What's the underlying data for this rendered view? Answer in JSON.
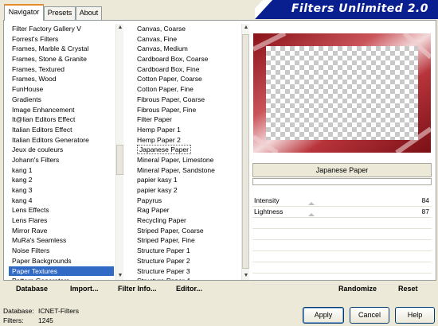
{
  "tabs": [
    "Navigator",
    "Presets",
    "About"
  ],
  "banner_title": "Filters Unlimited 2.0",
  "categories": [
    "Filter Factory Gallery V",
    "Forrest's Filters",
    "Frames, Marble & Crystal",
    "Frames, Stone & Granite",
    "Frames, Textured",
    "Frames, Wood",
    "FunHouse",
    "Gradients",
    "Image Enhancement",
    "It@lian Editors Effect",
    "Italian Editors Effect",
    "Italian Editors Generatore",
    "Jeux de couleurs",
    "Johann's Filters",
    "kang 1",
    "kang 2",
    "kang 3",
    "kang 4",
    "Lens Effects",
    "Lens Flares",
    "Mirror Rave",
    "MuRa's Seamless",
    "Noise Filters",
    "Paper Backgrounds",
    "Paper Textures",
    "Pattern Generators"
  ],
  "filters": [
    "Canvas, Coarse",
    "Canvas, Fine",
    "Canvas, Medium",
    "Cardboard Box, Coarse",
    "Cardboard Box, Fine",
    "Cotton Paper, Coarse",
    "Cotton Paper, Fine",
    "Fibrous Paper, Coarse",
    "Fibrous Paper, Fine",
    "Filter Paper",
    "Hemp Paper 1",
    "Hemp Paper 2",
    "Japanese Paper",
    "Mineral Paper, Limestone",
    "Mineral Paper, Sandstone",
    "papier kasy 1",
    "papier kasy 2",
    "Papyrus",
    "Rag Paper",
    "Recycling Paper",
    "Striped Paper, Coarse",
    "Striped Paper, Fine",
    "Structure Paper 1",
    "Structure Paper 2",
    "Structure Paper 3",
    "Structure Paper 4"
  ],
  "selected_category": "Paper Textures",
  "selected_filter": "Japanese Paper",
  "filter_name": "Japanese Paper",
  "params": [
    {
      "label": "Intensity",
      "value": "84"
    },
    {
      "label": "Lightness",
      "value": "87"
    }
  ],
  "buttons": {
    "database": "Database",
    "import": "Import...",
    "filter_info": "Filter Info...",
    "editor": "Editor...",
    "randomize": "Randomize",
    "reset": "Reset",
    "apply": "Apply",
    "cancel": "Cancel",
    "help": "Help"
  },
  "footer": {
    "database_label": "Database:",
    "database_value": "ICNET-Filters",
    "filters_label": "Filters:",
    "filters_value": "1245"
  },
  "colors": {
    "selection": "#316ac5",
    "banner": "#0a1f8f",
    "frame": "#9e1b22"
  }
}
